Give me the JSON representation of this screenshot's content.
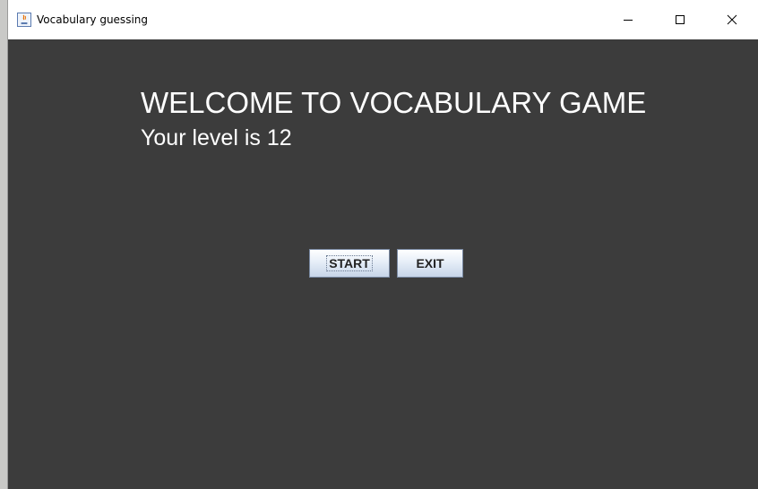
{
  "window": {
    "title": "Vocabulary guessing",
    "app_icon": "java-icon"
  },
  "main": {
    "welcome_text": "WELCOME TO VOCABULARY GAME",
    "level_text": "Your level is 12",
    "start_label": "START",
    "exit_label": "EXIT"
  },
  "colors": {
    "background": "#3c3c3c",
    "text": "#ffffff"
  }
}
